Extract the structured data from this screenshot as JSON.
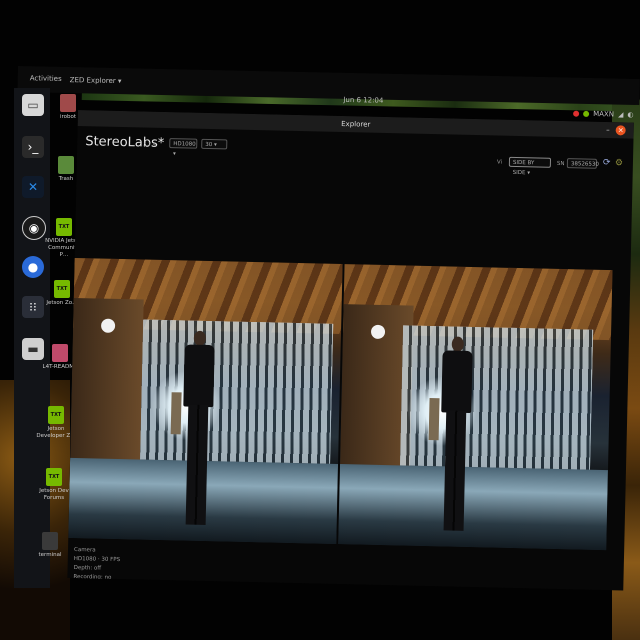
{
  "topbar": {
    "activities": "Activities",
    "app_menu": "ZED Explorer ▾",
    "clock": "Jun 6 12:04",
    "tray_text": "MAXN"
  },
  "dock": {
    "icons": [
      "files-icon",
      "terminal-icon",
      "vscode-icon",
      "obs-icon",
      "chromium-icon",
      "app-grid-icon",
      "drive-icon"
    ]
  },
  "desktop": {
    "icons": [
      {
        "label": "irobot",
        "icon": "home-folder-icon"
      },
      {
        "label": "Trash",
        "icon": "trash-icon"
      },
      {
        "label": "NVIDIA Jetson Community P…",
        "icon": "nvidia-icon"
      },
      {
        "label": "Jetson Zo…",
        "icon": "nvidia-icon"
      },
      {
        "label": "L4T-README",
        "icon": "drive-icon"
      },
      {
        "label": "Jetson Developer Z…",
        "icon": "nvidia-icon"
      },
      {
        "label": "Jetson Dev Forums",
        "icon": "nvidia-icon"
      },
      {
        "label": "terminal",
        "icon": "terminal-icon"
      }
    ]
  },
  "window": {
    "title": "Explorer",
    "brand": "StereoLabs*",
    "sdk_label": "3.7.4",
    "resolution": "HD1080",
    "fps": "30",
    "view_label": "Vi",
    "view_mode": "SIDE BY SIDE",
    "sn_label": "SN",
    "serial": "38526530"
  },
  "info_panel": [
    "Camera",
    "HD1080 · 30 FPS",
    "Depth: off",
    "Recording: no",
    "SVO: not loaded"
  ]
}
